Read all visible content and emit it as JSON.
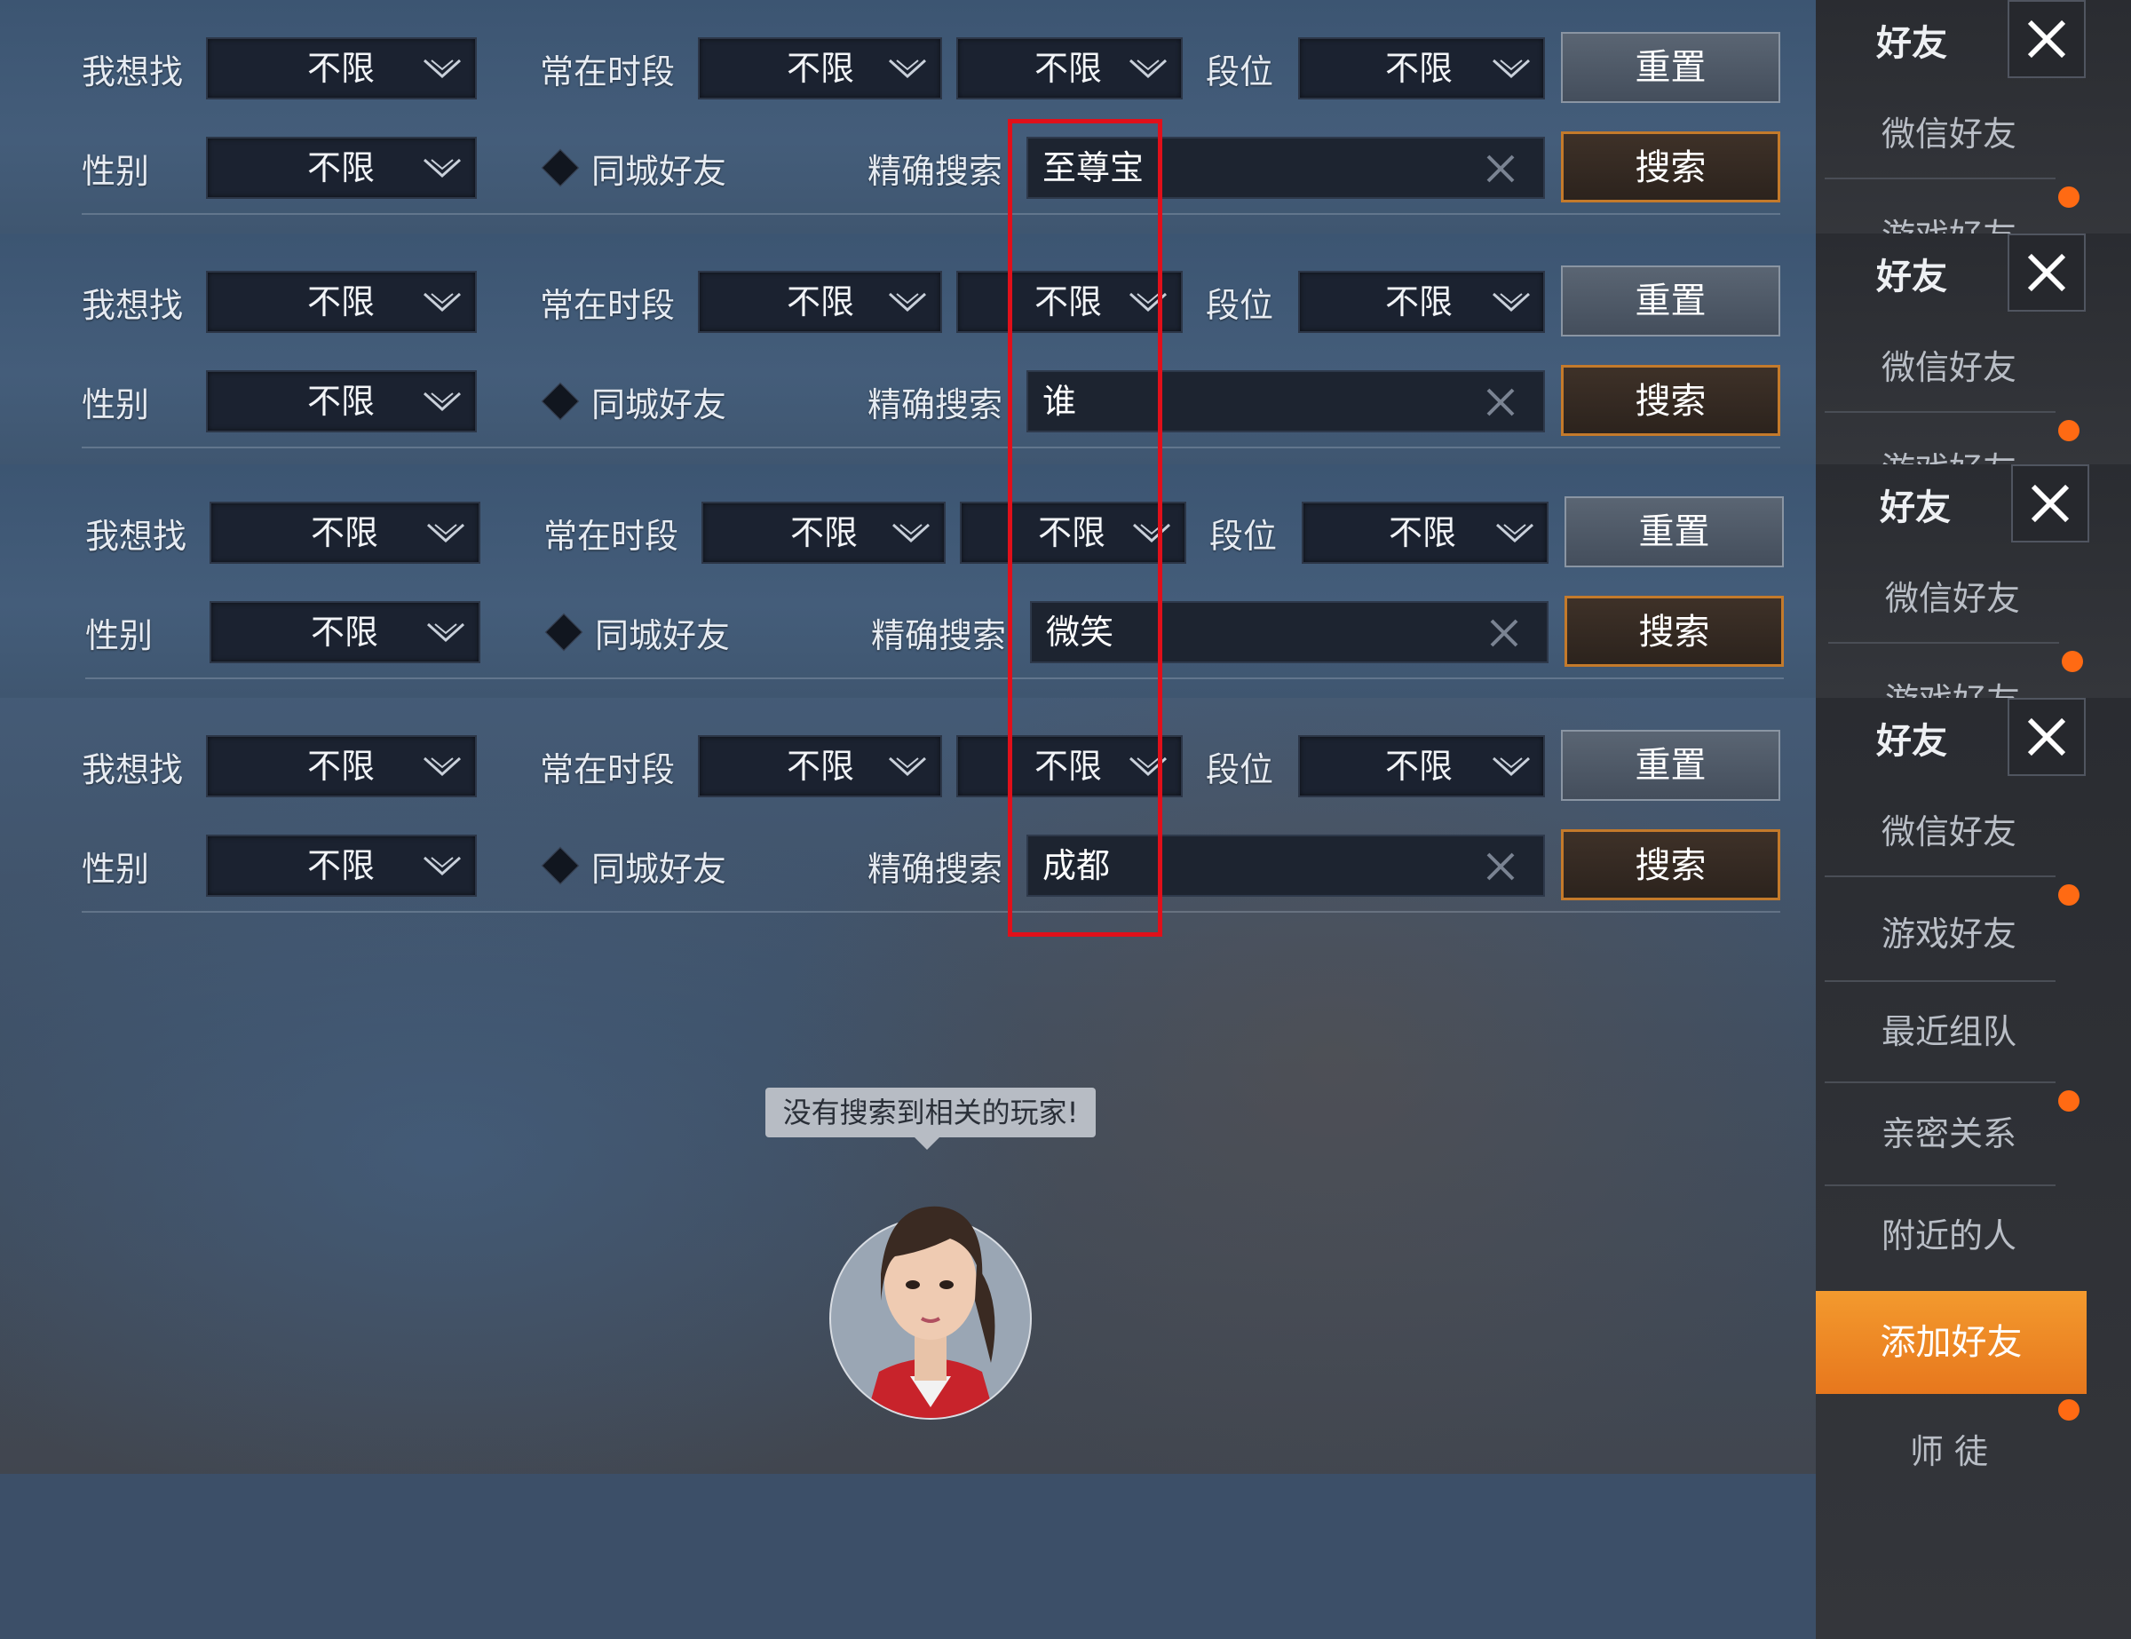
{
  "labels": {
    "want_find": "我想找",
    "active_time": "常在时段",
    "rank": "段位",
    "gender": "性别",
    "same_city": "同城好友",
    "exact_search": "精确搜索"
  },
  "dropdowns": {
    "want_find": "不限",
    "active_time_1": "不限",
    "active_time_2": "不限",
    "rank": "不限",
    "gender": "不限"
  },
  "buttons": {
    "reset": "重置",
    "search": "搜索"
  },
  "panels": [
    {
      "search_value": "至尊宝"
    },
    {
      "search_value": "谁"
    },
    {
      "search_value": "微笑"
    },
    {
      "search_value": "成都"
    }
  ],
  "sidebar": {
    "title": "好友",
    "items": [
      {
        "label": "微信好友"
      },
      {
        "label": "游戏好友"
      },
      {
        "label": "最近组队"
      },
      {
        "label": "亲密关系"
      },
      {
        "label": "附近的人"
      },
      {
        "label": "添加好友"
      },
      {
        "label": "师  徒"
      }
    ],
    "accent_color": "#f0891f",
    "badge_color": "#ff6a13"
  },
  "empty_state": {
    "message": "没有搜索到相关的玩家!"
  },
  "highlight_color": "#e0101a"
}
